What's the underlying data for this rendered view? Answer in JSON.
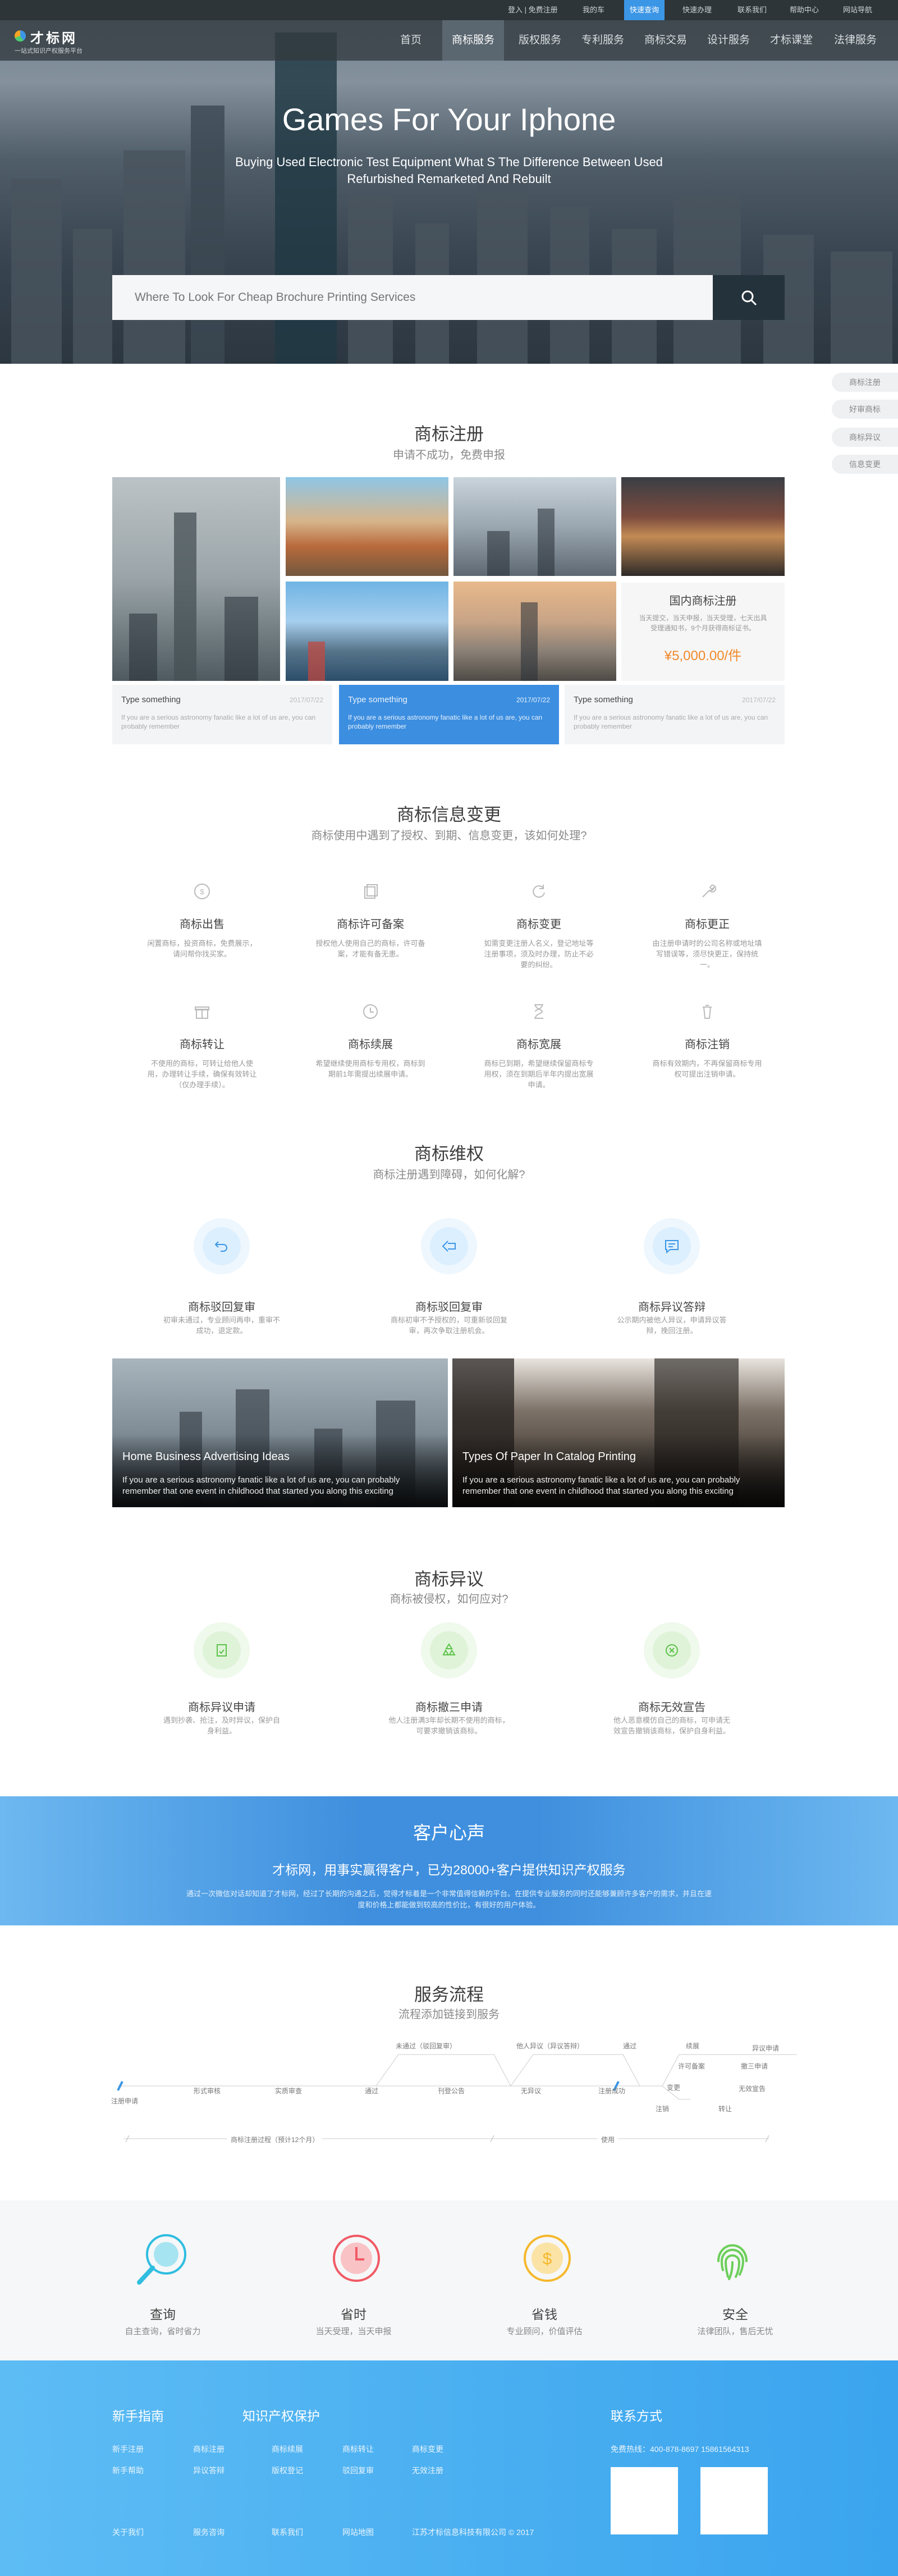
{
  "topbar": {
    "links": [
      "登入 | 免费注册",
      "我的车",
      "快速查询",
      "快速办理",
      "联系我们",
      "帮助中心",
      "网站导航"
    ]
  },
  "nav": {
    "logo_name": "才标网",
    "logo_tagline": "一站式知识产权服务平台",
    "items": [
      "首页",
      "商标服务",
      "版权服务",
      "专利服务",
      "商标交易",
      "设计服务",
      "才标课堂",
      "法律服务"
    ]
  },
  "hero": {
    "title": "Games For Your Iphone",
    "subtitle": "Buying Used Electronic Test Equipment What S The Difference Between Used Refurbished Remarketed And Rebuilt",
    "search_placeholder": "Where To Look For Cheap Brochure Printing Services"
  },
  "side_tabs": [
    "商标注册",
    "好审商标",
    "商标异议",
    "信息变更"
  ],
  "register": {
    "title": "商标注册",
    "subtitle": "申请不成功，免费申报",
    "product": {
      "title": "国内商标注册",
      "desc": "当天提交，当天申报，当天受理，七天出具受理通知书，9个月获得商标证书。",
      "price": "¥5,000.00/件"
    },
    "news": [
      {
        "title": "Type something",
        "date": "2017/07/22",
        "desc": "If you are a serious astronomy fanatic like a lot of us are, you can probably remember"
      },
      {
        "title": "Type something",
        "date": "2017/07/22",
        "desc": "If you are a serious astronomy fanatic like a lot of us are, you can probably remember"
      },
      {
        "title": "Type something",
        "date": "2017/07/22",
        "desc": "If you are a serious astronomy fanatic like a lot of us are, you can probably remember"
      }
    ]
  },
  "change": {
    "title": "商标信息变更",
    "subtitle": "商标使用中遇到了授权、到期、信息变更，该如何处理?",
    "items": [
      {
        "title": "商标出售",
        "desc": "闲置商标，投资商标，免费展示，请问帮你找买家。"
      },
      {
        "title": "商标许可备案",
        "desc": "授权他人使用自己的商标，许可备案，才能有备无患。"
      },
      {
        "title": "商标变更",
        "desc": "如需变更注册人名义，登记地址等注册事项，须及时办理，防止不必要的纠纷。"
      },
      {
        "title": "商标更正",
        "desc": "由注册申请时的公司名称或地址填写错误等，须尽快更正，保持统一。"
      },
      {
        "title": "商标转让",
        "desc": "不使用的商标，可转让给他人使用，办理转让手续，确保有效转让（仅办理手续）。"
      },
      {
        "title": "商标续展",
        "desc": "希望继续使用商标专用权，商标到期前1年需提出续展申请。"
      },
      {
        "title": "商标宽展",
        "desc": "商标已到期，希望继续保留商标专用权，须在到期后半年内提出宽展申请。"
      },
      {
        "title": "商标注销",
        "desc": "商标有效期内，不再保留商标专用权可提出注销申请。"
      }
    ]
  },
  "rights": {
    "title": "商标维权",
    "subtitle": "商标注册遇到障碍，如何化解?",
    "items": [
      {
        "title": "商标驳回复审",
        "desc": "初审未通过，专业顾问再申，重审不成功，退定款。"
      },
      {
        "title": "商标驳回复审",
        "desc": "商标初审不予授权的，可重新驳回复审，再次争取注册机会。"
      },
      {
        "title": "商标异议答辩",
        "desc": "公示期内被他人异议，申请异议答辩，挽回注册。"
      }
    ],
    "cards": [
      {
        "title": "Home Business Advertising Ideas",
        "desc": "If you are a serious astronomy fanatic like a lot of us are, you can probably remember that one event in childhood that started you along this exciting"
      },
      {
        "title": "Types Of Paper In Catalog Printing",
        "desc": "If you are a serious astronomy fanatic like a lot of us are, you can probably remember that one event in childhood that started you along this exciting"
      }
    ]
  },
  "objection": {
    "title": "商标异议",
    "subtitle": "商标被侵权，如何应对?",
    "items": [
      {
        "title": "商标异议申请",
        "desc": "遇到抄袭、抢注，及时异议，保护自身利益。"
      },
      {
        "title": "商标撤三申请",
        "desc": "他人注册满3年却长期不使用的商标，可要求撤销该商标。"
      },
      {
        "title": "商标无效宣告",
        "desc": "他人恶意模仿自己的商标，可申请无效宣告撤销该商标，保护自身利益。"
      }
    ]
  },
  "voice": {
    "title": "客户心声",
    "subtitle": "才标网，用事实赢得客户，已为28000+客户提供知识产权服务",
    "desc": "通过一次微信对话却知道了才标网，经过了长期的沟通之后，觉得才标着是一个非常值得信赖的平台。在提供专业服务的同时还能够兼顾许多客户的需求，并且在速度和价格上都能做到较高的性价比，有很好的用户体验。"
  },
  "process": {
    "title": "服务流程",
    "subtitle": "流程添加链接到服务",
    "steps_low": [
      "注册申请",
      "形式审核",
      "实质审查",
      "通过",
      "刊登公告",
      "无异议",
      "注册成功"
    ],
    "steps_high": [
      "未通过（驳回复审）",
      "他人异议（异议答辩）",
      "通过"
    ],
    "steps_right": [
      "续展",
      "异议申请",
      "许可备案",
      "撤三申请",
      "变更",
      "无效宣告",
      "注销",
      "转让"
    ],
    "bottom": [
      "商标注册过程（预计12个月）",
      "使用"
    ]
  },
  "values": [
    {
      "title": "查询",
      "desc": "自主查询，省时省力",
      "color": "#2fbde0"
    },
    {
      "title": "省时",
      "desc": "当天受理，当天申报",
      "color": "#f05a66"
    },
    {
      "title": "省钱",
      "desc": "专业顾问，价值评估",
      "color": "#f5b82c"
    },
    {
      "title": "安全",
      "desc": "法律团队，售后无忧",
      "color": "#6ccf5a"
    }
  ],
  "footer": {
    "col1_title": "新手指南",
    "col2_title": "知识产权保护",
    "contact_title": "联系方式",
    "links_row1": [
      "新手注册",
      "商标注册",
      "商标续展",
      "商标转让",
      "商标变更"
    ],
    "links_row2": [
      "新手帮助",
      "异议答辩",
      "版权登记",
      "驳回复审",
      "无效注册"
    ],
    "phone": "免费热线：400-878-8697   15861564313",
    "bottom_links": [
      "关于我们",
      "服务咨询",
      "联系我们",
      "网站地图"
    ],
    "copyright": "江苏才标信息科技有限公司 © 2017"
  }
}
